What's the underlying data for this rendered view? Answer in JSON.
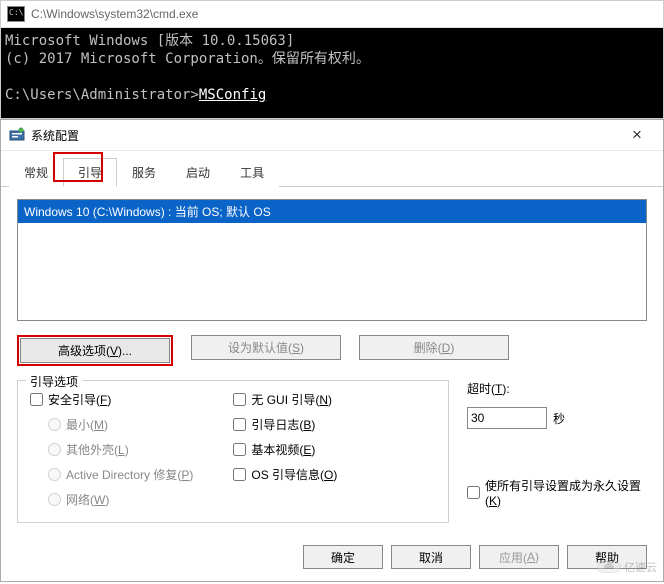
{
  "cmd": {
    "title": "C:\\Windows\\system32\\cmd.exe",
    "line1": "Microsoft Windows [版本 10.0.15063]",
    "line2": "(c) 2017 Microsoft Corporation。保留所有权利。",
    "prompt": "C:\\Users\\Administrator>",
    "command": "MSConfig"
  },
  "dlg": {
    "title": "系统配置",
    "tabs": {
      "general": "常规",
      "boot": "引导",
      "services": "服务",
      "startup": "启动",
      "tools": "工具"
    },
    "close": "×"
  },
  "list": {
    "item0": "Windows 10 (C:\\Windows) : 当前 OS; 默认 OS"
  },
  "buttons": {
    "advanced": "高级选项(<u>V</u>)...",
    "setdefault": "设为默认值(<u>S</u>)",
    "delete": "删除(<u>D</u>)"
  },
  "group": {
    "label": "引导选项",
    "safeboot": "安全引导(<u>F</u>)",
    "minimal": "最小(<u>M</u>)",
    "altshell": "其他外壳(<u>L</u>)",
    "adrepair": "Active Directory 修复(<u>P</u>)",
    "network": "网络(<u>W</u>)",
    "nogui": "无 GUI 引导(<u>N</u>)",
    "bootlog": "引导日志(<u>B</u>)",
    "basevideo": "基本视频(<u>E</u>)",
    "osinfo": "OS 引导信息(<u>O</u>)"
  },
  "timeout": {
    "label": "超时(<u>T</u>):",
    "value": "30",
    "unit": "秒",
    "permanent": "使所有引导设置成为永久设置(<u>K</u>)"
  },
  "footer": {
    "ok": "确定",
    "cancel": "取消",
    "apply": "应用(<u>A</u>)",
    "help": "帮助"
  },
  "watermark": "亿速云"
}
